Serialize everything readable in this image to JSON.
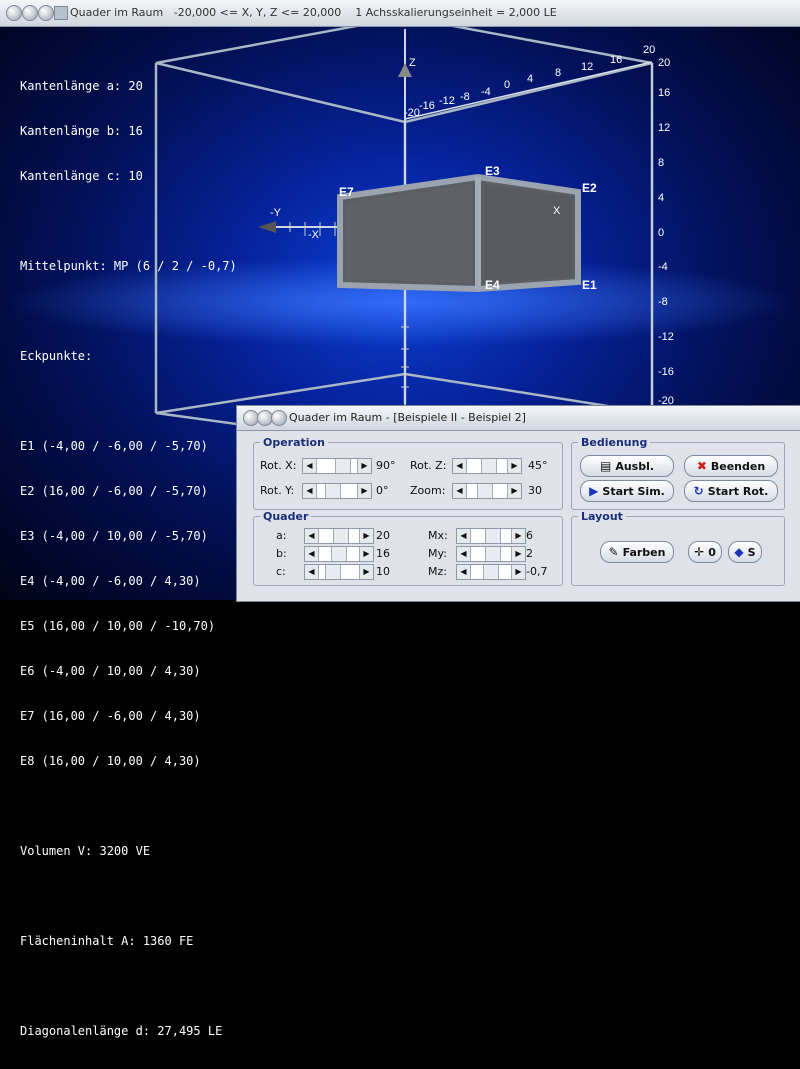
{
  "window": {
    "title": "Quader im Raum   -20,000 <= X, Y, Z <= 20,000    1 Achsskalierungseinheit = 2,000 LE"
  },
  "info": {
    "lines": [
      "Kantenlänge a: 20",
      "Kantenlänge b: 16",
      "Kantenlänge c: 10",
      "",
      "Mittelpunkt: MP (6 / 2 / -0,7)",
      "",
      "Eckpunkte:",
      "",
      "E1 (-4,00 / -6,00 / -5,70)",
      "E2 (16,00 / -6,00 / -5,70)",
      "E3 (-4,00 / 10,00 / -5,70)",
      "E4 (-4,00 / -6,00 / 4,30)",
      "E5 (16,00 / 10,00 / -10,70)",
      "E6 (-4,00 / 10,00 / 4,30)",
      "E7 (16,00 / -6,00 / 4,30)",
      "E8 (16,00 / 10,00 / 4,30)",
      "",
      "Volumen V: 3200 VE",
      "",
      "Flächeninhalt A: 1360 FE",
      "",
      "Diagonalenlänge d: 27,495 LE"
    ]
  },
  "axes": {
    "z_label": "Z",
    "x_label": "X",
    "neg_y_label": "-Y",
    "neg_x_label": "-X",
    "top_ticks": [
      "-20",
      "-16",
      "-12",
      "-8",
      "-4",
      "0",
      "4",
      "8",
      "12",
      "16",
      "20"
    ],
    "right_ticks": [
      "20",
      "16",
      "12",
      "8",
      "4",
      "0",
      "-4",
      "-8",
      "-12",
      "-16",
      "-20"
    ]
  },
  "vertices": {
    "E1": "E1",
    "E2": "E2",
    "E3": "E3",
    "E4": "E4",
    "E7": "E7"
  },
  "dialog": {
    "title": "Quader im Raum - [Beispiele II - Beispiel 2]",
    "operation": {
      "label": "Operation",
      "rot_x_label": "Rot. X:",
      "rot_x_value": "90°",
      "rot_y_label": "Rot. Y:",
      "rot_y_value": "0°",
      "rot_z_label": "Rot. Z:",
      "rot_z_value": "45°",
      "zoom_label": "Zoom:",
      "zoom_value": "30"
    },
    "quader": {
      "label": "Quader",
      "a_label": "a:",
      "a_value": "20",
      "b_label": "b:",
      "b_value": "16",
      "c_label": "c:",
      "c_value": "10",
      "mx_label": "Mx:",
      "mx_value": "6",
      "my_label": "My:",
      "my_value": "2",
      "mz_label": "Mz:",
      "mz_value": "-0,7"
    },
    "bedienung": {
      "label": "Bedienung",
      "ausbl": "Ausbl.",
      "beenden": "Beenden",
      "start_sim": "Start Sim.",
      "start_rot": "Start Rot."
    },
    "layout": {
      "label": "Layout",
      "farben": "Farben",
      "zero": "0",
      "s": "S"
    }
  }
}
